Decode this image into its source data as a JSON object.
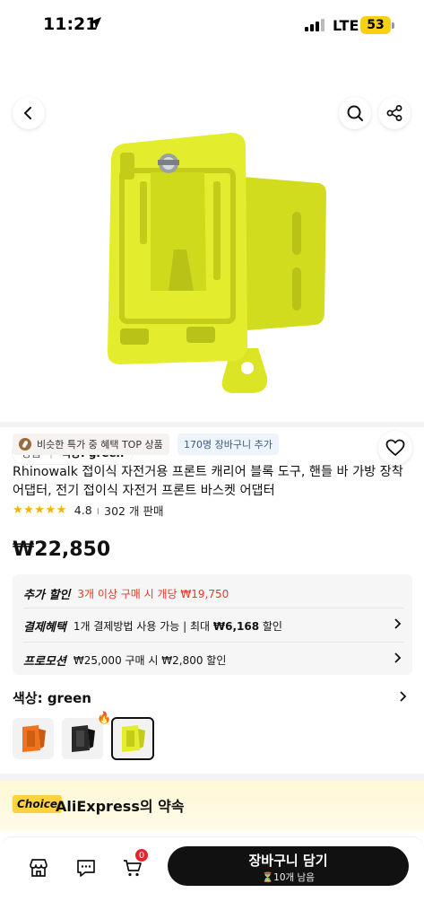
{
  "status_bar": {
    "time": "11:21",
    "network": "LTE",
    "battery": "53"
  },
  "hero": {
    "breadcrumb_category": "상품",
    "breadcrumb_color": "색상: green"
  },
  "badges": {
    "top_deal": "비슷한 특가 중 혜택 TOP 상품",
    "cart_count": "170명 장바구니 추가"
  },
  "product": {
    "title": "Rhinowalk 접이식 자전거용 프론트 캐리어 블록 도구, 핸들 바 가방 장착 어댑터, 전기 접이식 자전거 프론트 바스켓 어댑터",
    "rating": "4.8",
    "sold": "302 개 판매",
    "stars": "★★★★★",
    "price": "₩22,850"
  },
  "promotions": {
    "extra_label": "추가 할인",
    "extra_value": "3개 이상 구매 시 개당 ₩19,750",
    "payment_label": "결제혜택",
    "payment_value_pre": "1개 결제방법 사용 가능 | 최대 ",
    "payment_value_bold": "₩6,168",
    "payment_value_post": " 할인",
    "promo_label": "프로모션",
    "promo_value": "₩25,000 구매 시 ₩2,800 할인"
  },
  "color_section": {
    "heading": "색상: green",
    "options": [
      "orange",
      "black",
      "green"
    ],
    "selected": "green"
  },
  "choice": {
    "tag": "Choice",
    "text": "AliExpress의 약속"
  },
  "bottom_bar": {
    "cart_badge": "0",
    "cta_label": "장바구니 담기",
    "cta_sub": "⏳10개 남음"
  },
  "colors": {
    "product_yellow": "#e3ec2d",
    "accent_red": "#e23b2a",
    "cta_black": "#111111",
    "choice_yellow": "#ffd23f"
  }
}
